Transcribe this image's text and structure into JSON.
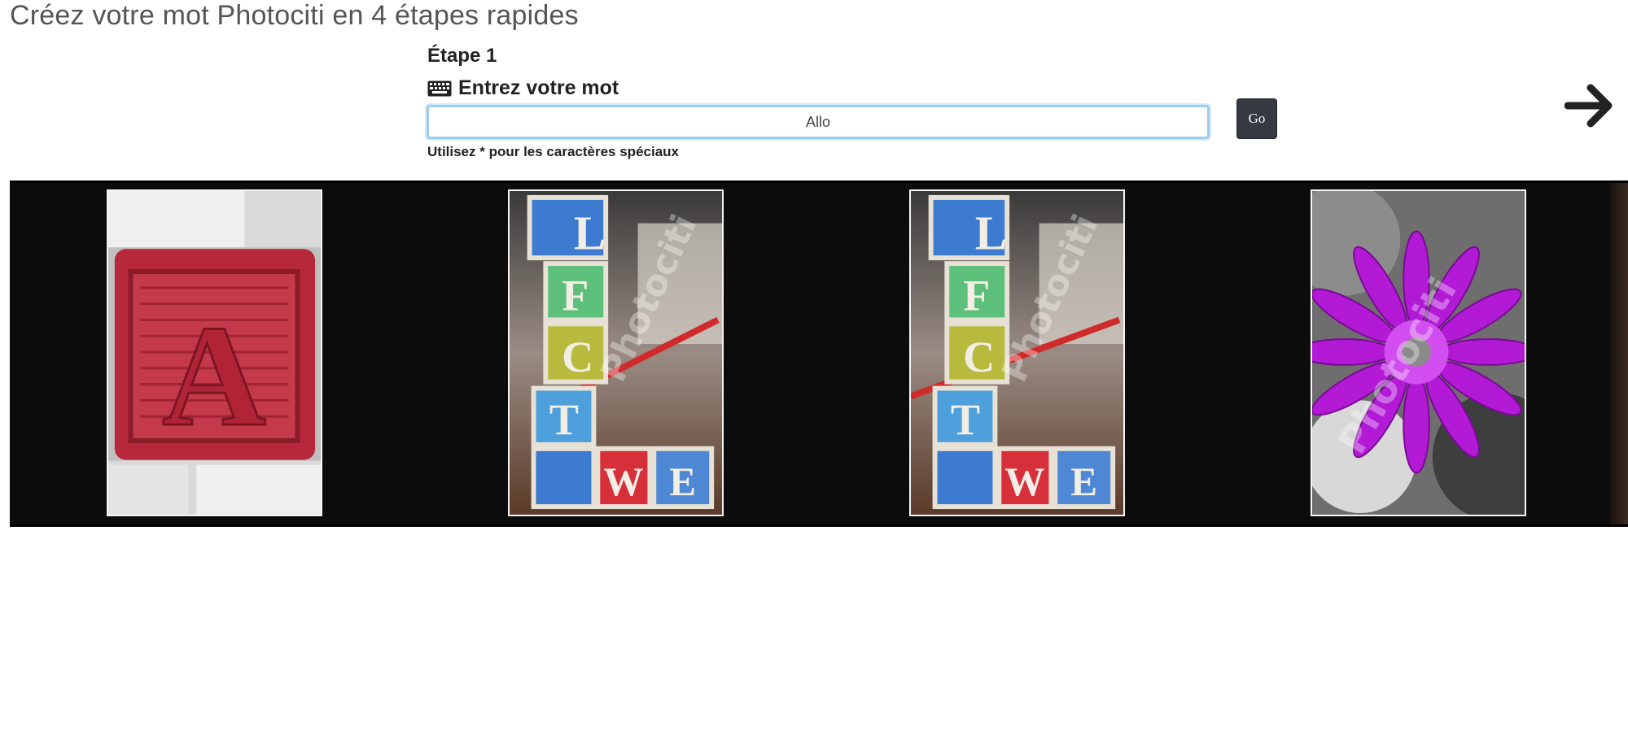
{
  "header": {
    "title": "Créez votre mot Photociti en 4 étapes rapides"
  },
  "step": {
    "label": "Étape 1",
    "title": "Entrez votre mot",
    "icon": "keyboard-icon"
  },
  "word_input": {
    "value": "Allo"
  },
  "go_button": {
    "label": "Go"
  },
  "hint": "Utilisez * pour les caractères spéciaux",
  "navigation": {
    "next_icon": "arrow-right-icon"
  },
  "letters": [
    {
      "letter": "A",
      "description": "Red wooden block letter A"
    },
    {
      "letter": "L",
      "description": "Stacked alphabet blocks spelling L"
    },
    {
      "letter": "L",
      "description": "Stacked alphabet blocks spelling L"
    },
    {
      "letter": "O",
      "description": "Purple flower O"
    }
  ],
  "watermark": "Photociti",
  "colors": {
    "strip_background": "#0c0c0c",
    "go_button": "#343a40",
    "input_focus_border": "#9ecbf0",
    "flower_purple": "#b21ad6",
    "block_red": "#c2283d"
  }
}
